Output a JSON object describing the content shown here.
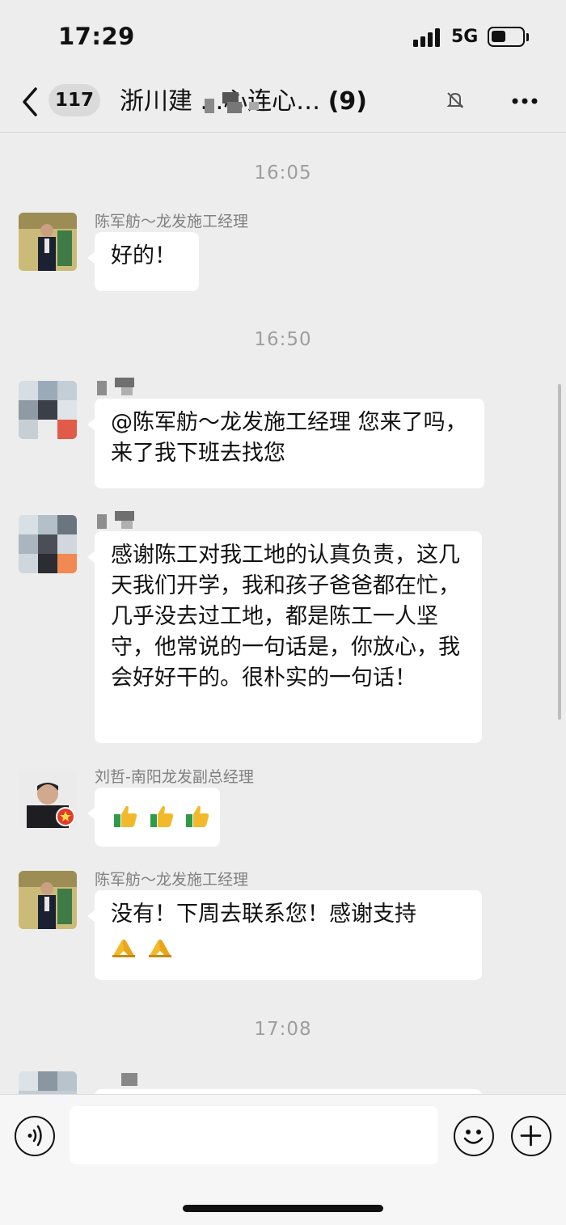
{
  "status_bar": {
    "time": "17:29",
    "network": "5G"
  },
  "nav": {
    "unread_count": "117",
    "title": "浙川建  .  .心连心…",
    "member_count": "(9)"
  },
  "messages": [
    {
      "type": "time",
      "text": "16:05"
    },
    {
      "type": "message",
      "sender": "陈军舫～龙发施工经理",
      "text": "好的！"
    },
    {
      "type": "time",
      "text": "16:50"
    },
    {
      "type": "message",
      "sender": "",
      "text": "@陈军舫～龙发施工经理 您来了吗，来了我下班去找您"
    },
    {
      "type": "message",
      "sender": "",
      "text": "感谢陈工对我工地的认真负责，这几天我们开学，我和孩子爸爸都在忙，几乎没去过工地，都是陈工一人坚守，他常说的一句话是，你放心，我会好好干的。很朴实的一句话！"
    },
    {
      "type": "message",
      "sender": "刘哲-南阳龙发副总经理",
      "emoji": "thumbs-up x3"
    },
    {
      "type": "message",
      "sender": "陈军舫～龙发施工经理",
      "text": "没有！下周去联系您！感谢支持",
      "emoji": "folded-hands x2"
    },
    {
      "type": "time",
      "text": "17:08"
    }
  ],
  "colors": {
    "background": "#ededed",
    "bubble": "#ffffff",
    "timestamp": "#9e9e9e",
    "sender_name": "#808080",
    "thumb_yellow": "#f3b92c",
    "thumb_green": "#2d9b4a"
  },
  "icons": {
    "back": "chevron-left-icon",
    "mute": "bell-slash-icon",
    "more": "ellipsis-icon",
    "voice": "voice-icon",
    "emoji": "smiley-icon",
    "plus": "plus-icon"
  }
}
